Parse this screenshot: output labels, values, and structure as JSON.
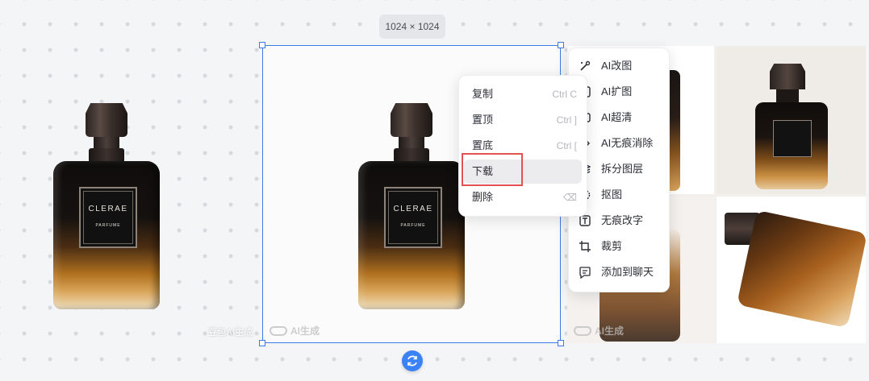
{
  "canvas": {
    "dimension_badge": "1024 × 1024",
    "left_watermark": "豆包AI生成",
    "ai_watermark": "AI生成"
  },
  "product": {
    "brand": "CLERAE",
    "subtitle": "PARFUME"
  },
  "context_menu": {
    "items": [
      {
        "label": "复制",
        "shortcut": "Ctrl C"
      },
      {
        "label": "置顶",
        "shortcut": "Ctrl ]"
      },
      {
        "label": "置底",
        "shortcut": "Ctrl ["
      },
      {
        "label": "下载",
        "shortcut": ""
      },
      {
        "label": "删除",
        "shortcut": "⌫"
      }
    ],
    "highlighted": "下载"
  },
  "ai_toolbar": {
    "items": [
      {
        "label": "AI改图",
        "icon": "magic-brush-icon"
      },
      {
        "label": "AI扩图",
        "icon": "expand-image-icon"
      },
      {
        "label": "AI超清",
        "icon": "hd-enhance-icon"
      },
      {
        "label": "AI无痕消除",
        "icon": "eraser-icon"
      },
      {
        "label": "拆分图层",
        "icon": "layers-icon"
      },
      {
        "label": "抠图",
        "icon": "cutout-icon"
      },
      {
        "label": "无痕改字",
        "icon": "text-edit-icon"
      },
      {
        "label": "裁剪",
        "icon": "crop-icon"
      },
      {
        "label": "添加到聊天",
        "icon": "chat-add-icon"
      }
    ]
  },
  "colors": {
    "selection": "#3b7be8",
    "highlight_border": "#e25252",
    "regen_button": "#3b82f6"
  }
}
